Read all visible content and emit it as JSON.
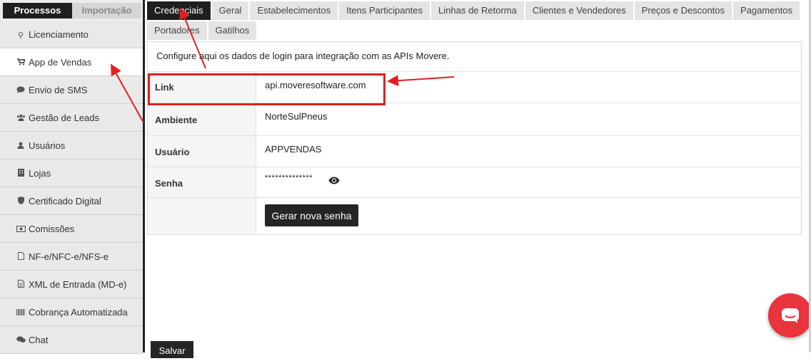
{
  "sidebar": {
    "tabs": [
      "Processos",
      "Importação"
    ],
    "items": [
      {
        "label": "Licenciamento",
        "icon": "key-icon"
      },
      {
        "label": "App de Vendas",
        "icon": "cart-icon"
      },
      {
        "label": "Envio de SMS",
        "icon": "comment-icon"
      },
      {
        "label": "Gestão de Leads",
        "icon": "users-group-icon"
      },
      {
        "label": "Usuários",
        "icon": "user-icon"
      },
      {
        "label": "Lojas",
        "icon": "building-icon"
      },
      {
        "label": "Certificado Digital",
        "icon": "shield-icon"
      },
      {
        "label": "Comissões",
        "icon": "money-icon"
      },
      {
        "label": "NF-e/NFC-e/NFS-e",
        "icon": "file-icon"
      },
      {
        "label": "XML de Entrada (MD-e)",
        "icon": "file-text-icon"
      },
      {
        "label": "Cobrança Automatizada",
        "icon": "barcode-icon"
      },
      {
        "label": "Chat",
        "icon": "chat-icon"
      }
    ],
    "active_index": 1
  },
  "tabs": {
    "row1": [
      "Credenciais",
      "Geral",
      "Estabelecimentos",
      "Itens Participantes",
      "Linhas de Retorma",
      "Clientes e Vendedores",
      "Preços e Descontos",
      "Pagamentos"
    ],
    "row2": [
      "Portadores",
      "Gatilhos"
    ],
    "active": "Credenciais"
  },
  "credentials": {
    "intro": "Configure aqui os dados de login para integração com as APIs Movere.",
    "link_label": "Link",
    "link_value": "api.moveresoftware.com",
    "ambiente_label": "Ambiente",
    "ambiente_value": "NorteSulPneus",
    "usuario_label": "Usuário",
    "usuario_value": "APPVENDAS",
    "senha_label": "Senha",
    "senha_value": "**************",
    "generate_button": "Gerar nova senha"
  },
  "footer": {
    "save_button": "Salvar"
  },
  "colors": {
    "dark": "#1f1f1f",
    "annotation_red": "#e02020",
    "chat_red": "#e8343d"
  }
}
